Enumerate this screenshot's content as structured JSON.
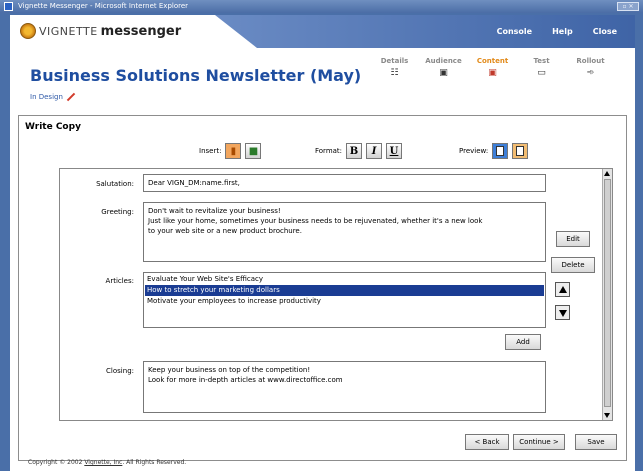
{
  "window": {
    "title": "Vignette Messenger - Microsoft Internet Explorer"
  },
  "brand": {
    "part1": "VIGNETTE",
    "part2": "messenger"
  },
  "topnav": [
    "Console",
    "Help",
    "Close"
  ],
  "page": {
    "title": "Business Solutions Newsletter (May)",
    "status": "In Design"
  },
  "steps": [
    {
      "label": "Details",
      "icon": "details-icon"
    },
    {
      "label": "Audience",
      "icon": "audience-icon"
    },
    {
      "label": "Content",
      "icon": "content-icon",
      "active": true
    },
    {
      "label": "Test",
      "icon": "test-icon"
    },
    {
      "label": "Rollout",
      "icon": "rollout-icon"
    }
  ],
  "panel": {
    "title": "Write Copy",
    "insert_label": "Insert:",
    "format_label": "Format:",
    "preview_label": "Preview:",
    "format_buttons": [
      "B",
      "I",
      "U"
    ]
  },
  "fields": {
    "salutation": {
      "label": "Salutation:",
      "value": "Dear VIGN_DM:name.first,"
    },
    "greeting": {
      "label": "Greeting:",
      "lines": [
        "Don't wait to revitalize your business!",
        "Just like your home, sometimes your business needs to be rejuvenated, whether it's a new look",
        "to your web site or a new product brochure."
      ]
    },
    "articles": {
      "label": "Articles:",
      "items": [
        "Evaluate Your Web Site's Efficacy",
        "How to stretch your marketing dollars",
        "Motivate your employees to increase productivity"
      ],
      "selected_index": 1
    },
    "closing": {
      "label": "Closing:",
      "lines": [
        "Keep your business on top of the competition!",
        "Look for more in-depth articles at www.directoffice.com"
      ]
    }
  },
  "buttons": {
    "edit": "Edit",
    "delete": "Delete",
    "add": "Add",
    "back": "< Back",
    "continue": "Continue >",
    "save": "Save"
  },
  "footer": {
    "copyright_pre": "Copyright © 2002 ",
    "company": "Vignette, Inc",
    "copyright_post": ". All Rights Reserved."
  },
  "colors": {
    "accent": "#1f4ea0",
    "active_step": "#e28a1a",
    "selection": "#1a3c93"
  }
}
